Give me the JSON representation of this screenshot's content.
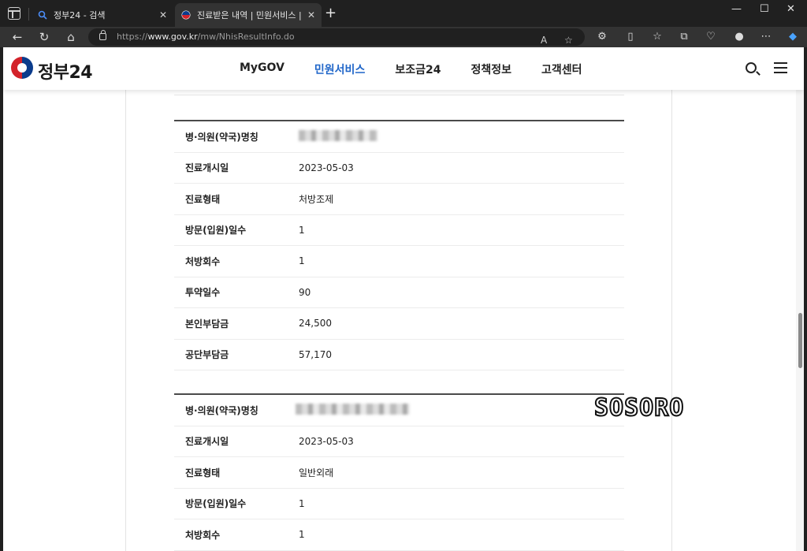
{
  "browser": {
    "tabs": [
      {
        "title": "정부24 - 검색"
      },
      {
        "title": "진료받은 내역 | 민원서비스 | 정부"
      }
    ],
    "url_prefix": "https://",
    "url_host": "www.gov.kr",
    "url_path": "/mw/NhisResultInfo.do"
  },
  "site": {
    "logo_text": "정부24",
    "nav": [
      {
        "label": "MyGOV"
      },
      {
        "label": "민원서비스"
      },
      {
        "label": "보조금24"
      },
      {
        "label": "정책정보"
      },
      {
        "label": "고객센터"
      }
    ],
    "active_color": "#2066c9"
  },
  "records": [
    {
      "rows": [
        {
          "label": "병·의원(약국)명칭",
          "value": ""
        },
        {
          "label": "진료개시일",
          "value": "2023-05-03"
        },
        {
          "label": "진료형태",
          "value": "처방조제"
        },
        {
          "label": "방문(입원)일수",
          "value": "1"
        },
        {
          "label": "처방회수",
          "value": "1"
        },
        {
          "label": "투약일수",
          "value": "90"
        },
        {
          "label": "본인부담금",
          "value": "24,500"
        },
        {
          "label": "공단부담금",
          "value": "57,170"
        }
      ]
    },
    {
      "rows": [
        {
          "label": "병·의원(약국)명칭",
          "value": ""
        },
        {
          "label": "진료개시일",
          "value": "2023-05-03"
        },
        {
          "label": "진료형태",
          "value": "일반외래"
        },
        {
          "label": "방문(입원)일수",
          "value": "1"
        },
        {
          "label": "처방회수",
          "value": "1"
        }
      ]
    }
  ],
  "watermark": "SOSORO"
}
